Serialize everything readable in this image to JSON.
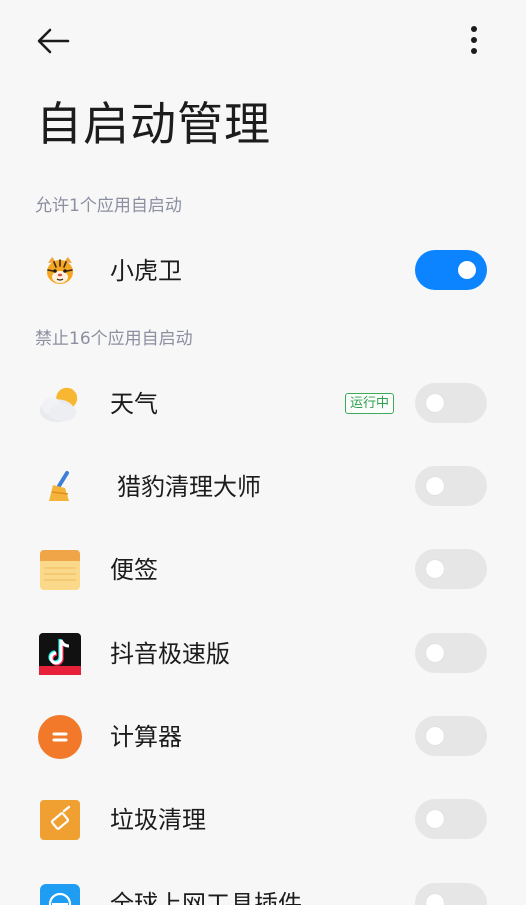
{
  "header": {
    "back_icon": "arrow-left-icon",
    "more_icon": "more-vertical-icon"
  },
  "page_title": "自启动管理",
  "sections": {
    "allowed_label": "允许1个应用自启动",
    "blocked_label": "禁止16个应用自启动"
  },
  "allowed_apps": [
    {
      "name": "小虎卫",
      "icon": "tiger-icon",
      "enabled": true
    }
  ],
  "blocked_apps": [
    {
      "name": "天气",
      "icon": "weather-icon",
      "enabled": false,
      "badge": "运行中"
    },
    {
      "name": "猎豹清理大师",
      "icon": "broom-icon",
      "enabled": false
    },
    {
      "name": "便签",
      "icon": "notes-icon",
      "enabled": false
    },
    {
      "name": "抖音极速版",
      "icon": "douyin-icon",
      "enabled": false
    },
    {
      "name": "计算器",
      "icon": "calculator-icon",
      "enabled": false
    },
    {
      "name": "垃圾清理",
      "icon": "cleaner-icon",
      "enabled": false
    },
    {
      "name": "全球上网工具插件",
      "icon": "globe-icon",
      "enabled": false
    }
  ],
  "colors": {
    "switch_on": "#0d84ff",
    "switch_off": "#e6e6e6",
    "badge_green": "#2f9d4e",
    "section_label": "#8c8fa0",
    "background": "#f7f7f7"
  }
}
